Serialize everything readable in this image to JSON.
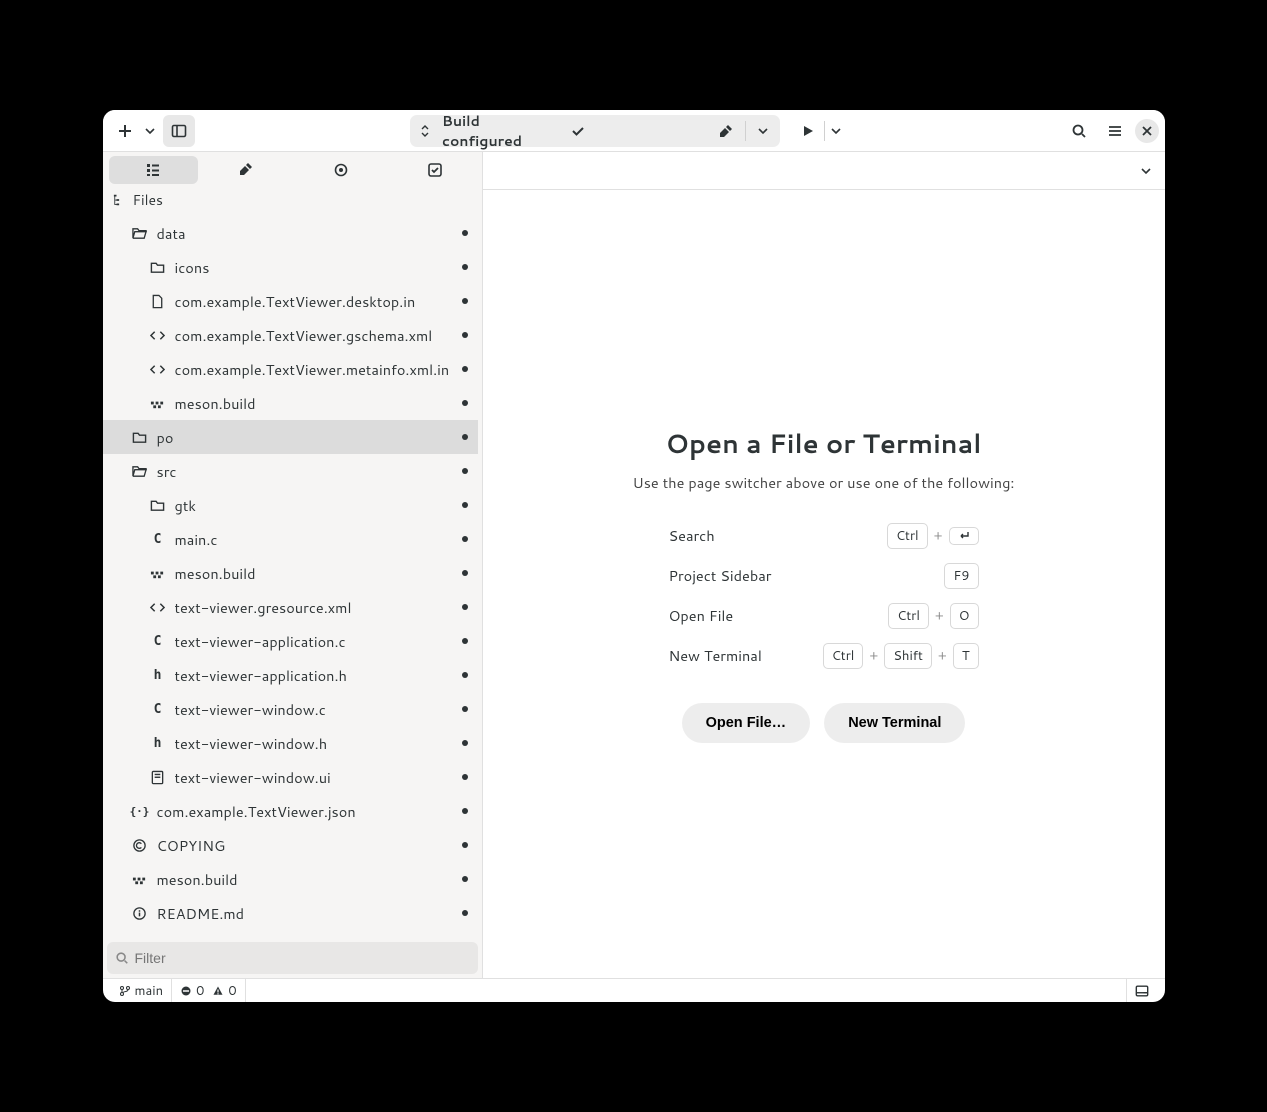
{
  "header": {
    "build_status": "Build configured"
  },
  "sidebar": {
    "header_label": "Files",
    "filter_placeholder": "Filter",
    "tree": [
      {
        "icon": "folder-open",
        "label": "data",
        "depth": 1,
        "dot": true
      },
      {
        "icon": "folder",
        "label": "icons",
        "depth": 2,
        "dot": true
      },
      {
        "icon": "file",
        "label": "com.example.TextViewer.desktop.in",
        "depth": 2,
        "dot": true
      },
      {
        "icon": "code",
        "label": "com.example.TextViewer.gschema.xml",
        "depth": 2,
        "dot": true
      },
      {
        "icon": "code",
        "label": "com.example.TextViewer.metainfo.xml.in",
        "depth": 2,
        "dot": true
      },
      {
        "icon": "meson",
        "label": "meson.build",
        "depth": 2,
        "dot": true
      },
      {
        "icon": "folder",
        "label": "po",
        "depth": 1,
        "dot": true,
        "selected": true
      },
      {
        "icon": "folder-open",
        "label": "src",
        "depth": 1,
        "dot": true
      },
      {
        "icon": "folder",
        "label": "gtk",
        "depth": 2,
        "dot": true
      },
      {
        "icon": "c",
        "label": "main.c",
        "depth": 2,
        "dot": true
      },
      {
        "icon": "meson",
        "label": "meson.build",
        "depth": 2,
        "dot": true
      },
      {
        "icon": "code",
        "label": "text-viewer.gresource.xml",
        "depth": 2,
        "dot": true
      },
      {
        "icon": "c",
        "label": "text-viewer-application.c",
        "depth": 2,
        "dot": true
      },
      {
        "icon": "h",
        "label": "text-viewer-application.h",
        "depth": 2,
        "dot": true
      },
      {
        "icon": "c",
        "label": "text-viewer-window.c",
        "depth": 2,
        "dot": true
      },
      {
        "icon": "h",
        "label": "text-viewer-window.h",
        "depth": 2,
        "dot": true
      },
      {
        "icon": "ui",
        "label": "text-viewer-window.ui",
        "depth": 2,
        "dot": true
      },
      {
        "icon": "json",
        "label": "com.example.TextViewer.json",
        "depth": 1,
        "dot": true
      },
      {
        "icon": "copyright",
        "label": "COPYING",
        "depth": 1,
        "dot": true
      },
      {
        "icon": "meson",
        "label": "meson.build",
        "depth": 1,
        "dot": true
      },
      {
        "icon": "info",
        "label": "README.md",
        "depth": 1,
        "dot": true
      }
    ]
  },
  "empty": {
    "title": "Open a File or Terminal",
    "subtitle": "Use the page switcher above or use one of the following:",
    "shortcuts": [
      {
        "label": "Search",
        "keys": [
          "Ctrl",
          "+",
          "↵"
        ]
      },
      {
        "label": "Project Sidebar",
        "keys": [
          "F9"
        ]
      },
      {
        "label": "Open File",
        "keys": [
          "Ctrl",
          "+",
          "O"
        ]
      },
      {
        "label": "New Terminal",
        "keys": [
          "Ctrl",
          "+",
          "Shift",
          "+",
          "T"
        ]
      }
    ],
    "open_file_btn": "Open File…",
    "new_terminal_btn": "New Terminal"
  },
  "status": {
    "branch": "main",
    "errors": "0",
    "warnings": "0"
  }
}
